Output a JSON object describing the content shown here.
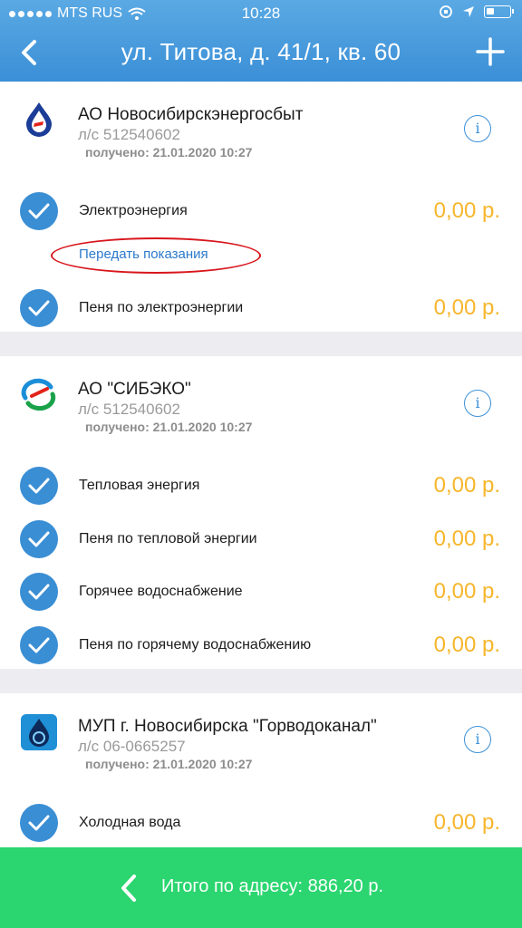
{
  "status": {
    "carrier": "MTS RUS",
    "time": "10:28"
  },
  "nav": {
    "title": "ул. Титова, д. 41/1, кв. 60"
  },
  "providers": [
    {
      "name": "АО Новосибирскэнергосбыт",
      "account": "л/с 512540602",
      "received": "получено: 21.01.2020 10:27",
      "services": [
        {
          "label": "Электроэнергия",
          "amount": "0,00 р."
        },
        {
          "label": "Пеня по электроэнергии",
          "amount": "0,00 р."
        }
      ],
      "action_link": "Передать показания"
    },
    {
      "name": "АО \"СИБЭКО\"",
      "account": "л/с 512540602",
      "received": "получено: 21.01.2020 10:27",
      "services": [
        {
          "label": "Тепловая энергия",
          "amount": "0,00 р."
        },
        {
          "label": "Пеня по тепловой энергии",
          "amount": "0,00 р."
        },
        {
          "label": "Горячее водоснабжение",
          "amount": "0,00 р."
        },
        {
          "label": "Пеня по горячему водоснабжению",
          "amount": "0,00 р."
        }
      ]
    },
    {
      "name": "МУП г. Новосибирска \"Горводоканал\"",
      "account": "л/с 06-0665257",
      "received": "получено: 21.01.2020 10:27",
      "services": [
        {
          "label": "Холодная вода",
          "amount": "0,00 р."
        }
      ]
    }
  ],
  "footer": {
    "total": "Итого по адресу: 886,20 р."
  },
  "colors": {
    "header": "#3b8fd6",
    "check": "#3a8ed4",
    "amount": "#f6b62c",
    "footer": "#2bd56f",
    "link": "#2b79cc",
    "annotation": "#d8161c"
  }
}
